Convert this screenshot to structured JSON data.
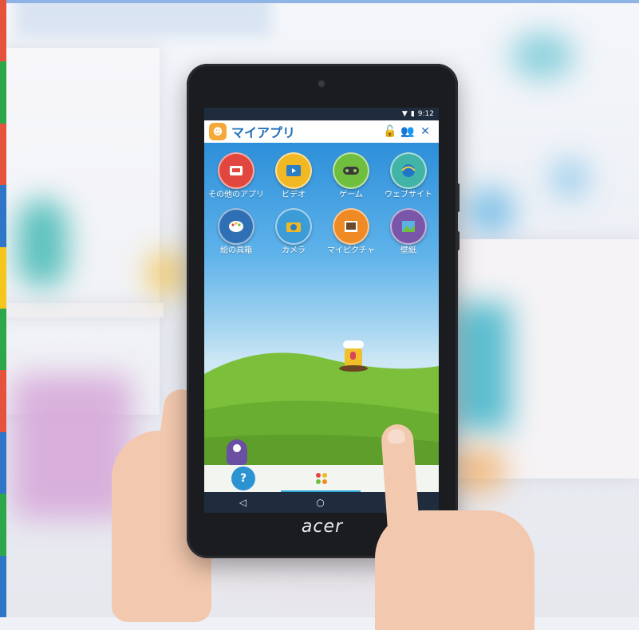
{
  "status_bar": {
    "time": "9:12"
  },
  "app_bar": {
    "title": "マイアプリ"
  },
  "apps": [
    {
      "label": "その他のアプリ",
      "icon": "other-apps-icon",
      "color": "#e2473f"
    },
    {
      "label": "ビデオ",
      "icon": "video-icon",
      "color": "#f2b823"
    },
    {
      "label": "ゲーム",
      "icon": "game-icon",
      "color": "#6fbe3e"
    },
    {
      "label": "ウェブサイト",
      "icon": "website-icon",
      "color": "#41b4a7"
    },
    {
      "label": "絵の具箱",
      "icon": "paint-palette-icon",
      "color": "#2f6fb4"
    },
    {
      "label": "カメラ",
      "icon": "camera-icon",
      "color": "#3c9cd7"
    },
    {
      "label": "マイピクチャ",
      "icon": "my-pictures-icon",
      "color": "#ef8a25"
    },
    {
      "label": "壁紙",
      "icon": "wallpaper-icon",
      "color": "#7a56a9"
    }
  ],
  "bottom_nav": {
    "items": [
      "help-mascot-icon",
      "apps-grid-icon"
    ]
  },
  "device": {
    "brand": "acer"
  },
  "colors": {
    "accent": "#1f6fb8",
    "status_bar": "#1f2c3d",
    "grass": "#7cbf3a"
  }
}
